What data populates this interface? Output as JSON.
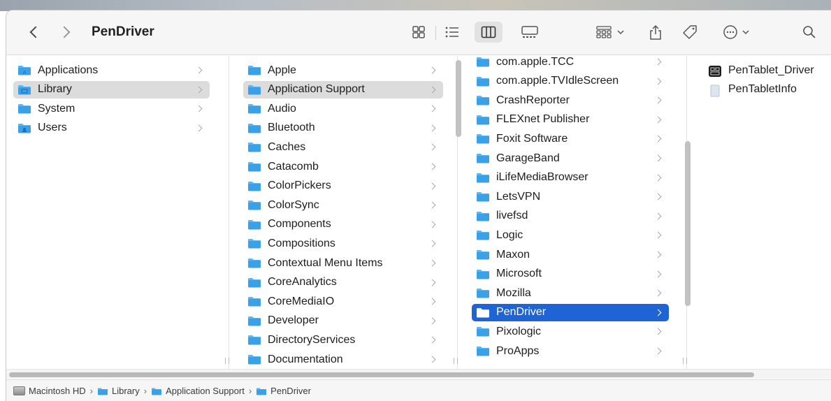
{
  "window": {
    "title": "PenDriver"
  },
  "toolbar": {
    "icons": [
      "chevron-left-icon",
      "chevron-right-icon",
      "icon-view-icon",
      "list-view-icon",
      "column-view-icon",
      "gallery-view-icon",
      "group-icon",
      "share-icon",
      "tag-icon",
      "more-icon",
      "search-icon"
    ],
    "selected_view": "column-view"
  },
  "columns": [
    {
      "items": [
        {
          "label": "Applications",
          "icon": "applications-folder-icon",
          "state": "normal"
        },
        {
          "label": "Library",
          "icon": "library-folder-icon",
          "state": "gray"
        },
        {
          "label": "System",
          "icon": "folder-icon",
          "state": "normal"
        },
        {
          "label": "Users",
          "icon": "users-folder-icon",
          "state": "normal"
        }
      ]
    },
    {
      "items": [
        {
          "label": "Apple",
          "state": "normal"
        },
        {
          "label": "Application Support",
          "state": "gray"
        },
        {
          "label": "Audio",
          "state": "normal"
        },
        {
          "label": "Bluetooth",
          "state": "normal"
        },
        {
          "label": "Caches",
          "state": "normal"
        },
        {
          "label": "Catacomb",
          "state": "normal"
        },
        {
          "label": "ColorPickers",
          "state": "normal"
        },
        {
          "label": "ColorSync",
          "state": "normal"
        },
        {
          "label": "Components",
          "state": "normal"
        },
        {
          "label": "Compositions",
          "state": "normal"
        },
        {
          "label": "Contextual Menu Items",
          "state": "normal"
        },
        {
          "label": "CoreAnalytics",
          "state": "normal"
        },
        {
          "label": "CoreMediaIO",
          "state": "normal"
        },
        {
          "label": "Developer",
          "state": "normal"
        },
        {
          "label": "DirectoryServices",
          "state": "normal"
        },
        {
          "label": "Documentation",
          "state": "normal"
        }
      ]
    },
    {
      "items": [
        {
          "label": "com.apple.TCC",
          "state": "normal"
        },
        {
          "label": "com.apple.TVIdleScreen",
          "state": "normal"
        },
        {
          "label": "CrashReporter",
          "state": "normal"
        },
        {
          "label": "FLEXnet Publisher",
          "state": "normal"
        },
        {
          "label": "Foxit Software",
          "state": "normal"
        },
        {
          "label": "GarageBand",
          "state": "normal"
        },
        {
          "label": "iLifeMediaBrowser",
          "state": "normal"
        },
        {
          "label": "LetsVPN",
          "state": "normal"
        },
        {
          "label": "livefsd",
          "state": "normal"
        },
        {
          "label": "Logic",
          "state": "normal"
        },
        {
          "label": "Maxon",
          "state": "normal"
        },
        {
          "label": "Microsoft",
          "state": "normal"
        },
        {
          "label": "Mozilla",
          "state": "normal"
        },
        {
          "label": "PenDriver",
          "state": "blue"
        },
        {
          "label": "Pixologic",
          "state": "normal"
        },
        {
          "label": "ProApps",
          "state": "normal"
        }
      ]
    },
    {
      "items": [
        {
          "label": "PenTablet_Driver",
          "icon": "executable-icon",
          "state": "normal"
        },
        {
          "label": "PenTabletInfo",
          "icon": "document-icon",
          "state": "normal"
        }
      ]
    }
  ],
  "pathbar": {
    "crumbs": [
      "Macintosh HD",
      "Library",
      "Application Support",
      "PenDriver"
    ]
  },
  "colors": {
    "accent": "#1f64d4",
    "folder": "#3aa0e8",
    "selection_inactive": "#dcdcdc"
  }
}
